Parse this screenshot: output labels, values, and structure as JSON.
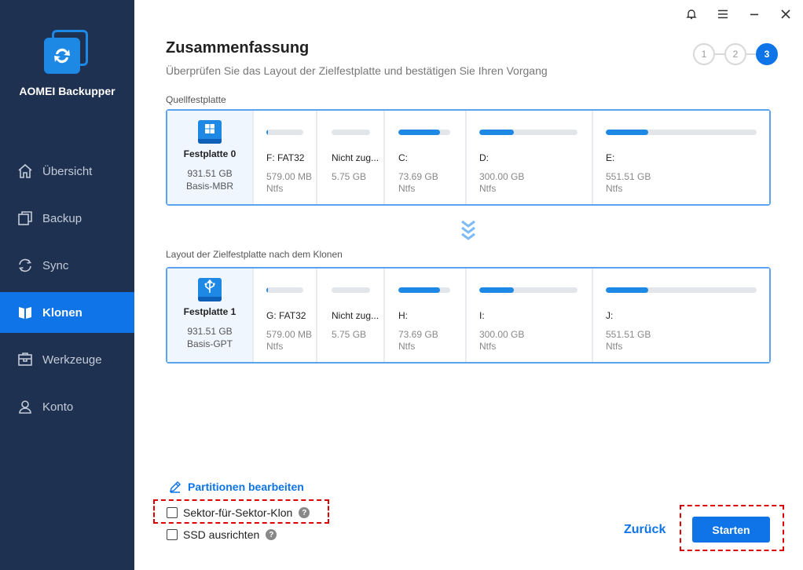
{
  "app": {
    "name": "AOMEI Backupper"
  },
  "sidebar": {
    "items": [
      {
        "label": "Übersicht",
        "icon": "home-icon"
      },
      {
        "label": "Backup",
        "icon": "backup-icon"
      },
      {
        "label": "Sync",
        "icon": "sync-icon"
      },
      {
        "label": "Klonen",
        "icon": "clone-icon",
        "active": true
      },
      {
        "label": "Werkzeuge",
        "icon": "tools-icon"
      },
      {
        "label": "Konto",
        "icon": "user-icon"
      }
    ]
  },
  "titlebar": {
    "icons": [
      "bell-icon",
      "menu-icon",
      "minimize-icon",
      "close-icon"
    ]
  },
  "header": {
    "title": "Zusammenfassung",
    "subtitle": "Überprüfen Sie das Layout der Zielfestplatte und bestätigen Sie Ihren Vorgang"
  },
  "steps": [
    "1",
    "2",
    "3"
  ],
  "source": {
    "section_label": "Quellfestplatte",
    "disk": {
      "name": "Festplatte 0",
      "size": "931.51 GB",
      "type": "Basis-MBR"
    },
    "partitions": [
      {
        "label": "F: FAT32",
        "size": "579.00 MB",
        "fs": "Ntfs",
        "fill": 0.05
      },
      {
        "label": "Nicht zug...",
        "size": "5.75 GB",
        "fs": "",
        "fill": 0
      },
      {
        "label": "C:",
        "size": "73.69 GB",
        "fs": "Ntfs",
        "fill": 0.8
      },
      {
        "label": "D:",
        "size": "300.00 GB",
        "fs": "Ntfs",
        "fill": 0.35
      },
      {
        "label": "E:",
        "size": "551.51 GB",
        "fs": "Ntfs",
        "fill": 0.28
      }
    ]
  },
  "target": {
    "section_label": "Layout der Zielfestplatte nach dem Klonen",
    "disk": {
      "name": "Festplatte 1",
      "size": "931.51 GB",
      "type": "Basis-GPT"
    },
    "partitions": [
      {
        "label": "G: FAT32",
        "size": "579.00 MB",
        "fs": "Ntfs",
        "fill": 0.05
      },
      {
        "label": "Nicht zug...",
        "size": "5.75 GB",
        "fs": "",
        "fill": 0
      },
      {
        "label": "H:",
        "size": "73.69 GB",
        "fs": "Ntfs",
        "fill": 0.8
      },
      {
        "label": "I:",
        "size": "300.00 GB",
        "fs": "Ntfs",
        "fill": 0.35
      },
      {
        "label": "J:",
        "size": "551.51 GB",
        "fs": "Ntfs",
        "fill": 0.28
      }
    ]
  },
  "options": {
    "edit_partitions": "Partitionen bearbeiten",
    "sector_clone": "Sektor-für-Sektor-Klon",
    "ssd_align": "SSD ausrichten",
    "help_glyph": "?"
  },
  "footer": {
    "back": "Zurück",
    "start": "Starten"
  },
  "colors": {
    "sidebar": "#1f3150",
    "accent": "#0e74e8",
    "highlight": "#dd0000"
  }
}
